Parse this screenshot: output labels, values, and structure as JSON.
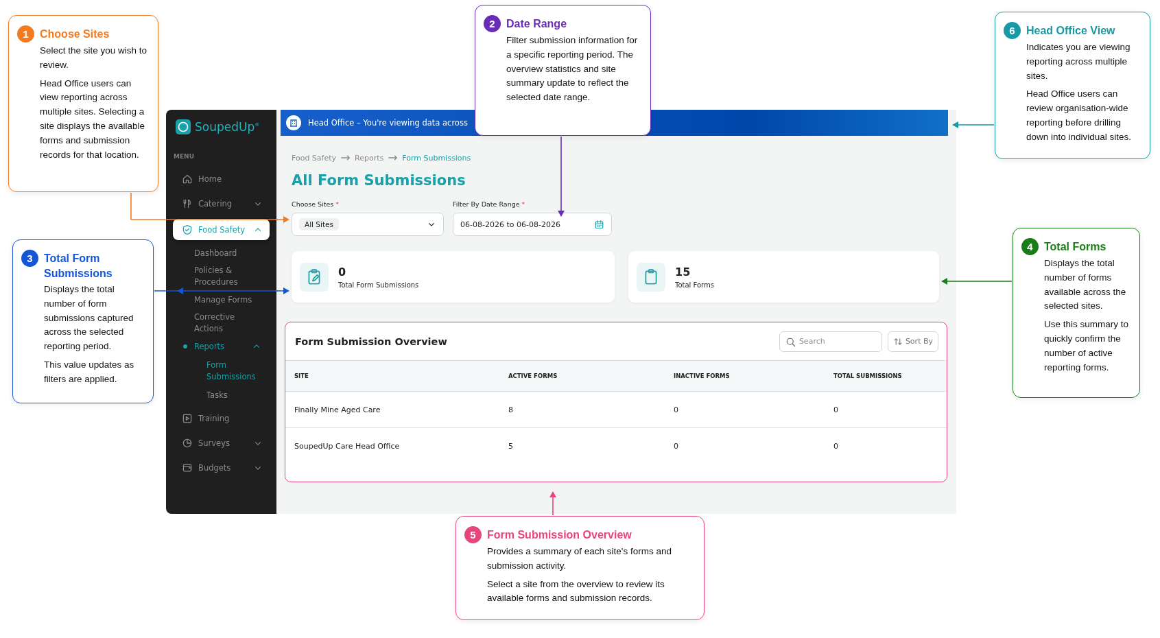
{
  "sidebar": {
    "logo": "SoupedUp$^{®}$",
    "section_label": "MENU",
    "items": [
      {
        "label": "Home",
        "selected": false
      },
      {
        "label": "Catering",
        "selected": false,
        "expanded": false
      },
      {
        "label": "Food Safety",
        "selected": true,
        "expanded": true,
        "children": [
          {
            "label": "Dashboard",
            "selected": false
          },
          {
            "label": "Policies & Procedures",
            "selected": false
          },
          {
            "label": "Manage Forms",
            "selected": false
          },
          {
            "label": "Corrective Actions",
            "selected": false
          },
          {
            "label": "Reports",
            "selected": true,
            "expanded": true,
            "children": [
              {
                "label": "Form Submissions",
                "selected": true
              },
              {
                "label": "Tasks",
                "selected": false
              }
            ]
          }
        ]
      },
      {
        "label": "Training",
        "selected": false
      },
      {
        "label": "Surveys",
        "selected": false,
        "expanded": false
      },
      {
        "label": "Budgets",
        "selected": false,
        "expanded": false
      }
    ]
  },
  "banner": {
    "text": "Head Office – You're viewing data across"
  },
  "breadcrumb": [
    {
      "label": "Food Safety",
      "selected": false
    },
    {
      "label": "Reports",
      "selected": false
    },
    {
      "label": "Form Submissions",
      "selected": true
    }
  ],
  "page_title": "All Form Submissions",
  "filters": [
    {
      "kind": "select",
      "label": "Choose Sites",
      "required_mark": "*",
      "value": "All Sites"
    },
    {
      "kind": "date",
      "label": "Filter By Date Range",
      "required_mark": "*",
      "value": "06-08-2026 to 06-08-2026"
    }
  ],
  "stats": [
    {
      "value": "0",
      "label": "Total Form Submissions"
    },
    {
      "value": "15",
      "label": "Total Forms"
    }
  ],
  "table": {
    "title": "Form Submission Overview",
    "search": {
      "placeholder": "Search"
    },
    "sort_button": "Sort By",
    "columns": [
      "SITE",
      "ACTIVE FORMS",
      "INACTIVE FORMS",
      "TOTAL SUBMISSIONS"
    ],
    "rows": [
      [
        "Finally Mine Aged Care",
        "8",
        "0",
        "0"
      ],
      [
        "SoupedUp Care Head Office",
        "5",
        "0",
        "0"
      ]
    ]
  },
  "callouts": [
    {
      "number": "1",
      "title": "Choose Sites",
      "color": "#f47b20",
      "paragraphs": [
        "Select the site you wish to review.",
        "Head Office users can view reporting across multiple sites. Selecting a site displays the available forms and submission records for that location."
      ]
    },
    {
      "number": "2",
      "title": "Date Range",
      "color": "#6a2bb8",
      "paragraphs": [
        "Filter submission information for a specific reporting period. The overview statistics and site summary update to reflect the selected date range."
      ]
    },
    {
      "number": "3",
      "title": "Total Form Submissions",
      "color": "#1456d8",
      "paragraphs": [
        "Displays the total number of form submissions captured across the selected reporting period.",
        "This value updates as filters are applied."
      ]
    },
    {
      "number": "4",
      "title": "Total Forms",
      "color": "#1a7d1a",
      "paragraphs": [
        "Displays the total number of forms available across the selected sites.",
        "Use this summary to quickly confirm the number of active reporting forms."
      ]
    },
    {
      "number": "5",
      "title": "Form Submission Overview",
      "color": "#e8457f",
      "paragraphs": [
        "Provides a summary of each site's forms and submission activity.",
        "Select a site from the overview to review its available forms and submission records."
      ]
    },
    {
      "number": "6",
      "title": "Head Office View",
      "color": "#169aa6",
      "paragraphs": [
        "Indicates you are viewing reporting across multiple sites.",
        "Head Office users can review organisation-wide reporting before drilling down into individual sites."
      ]
    }
  ]
}
